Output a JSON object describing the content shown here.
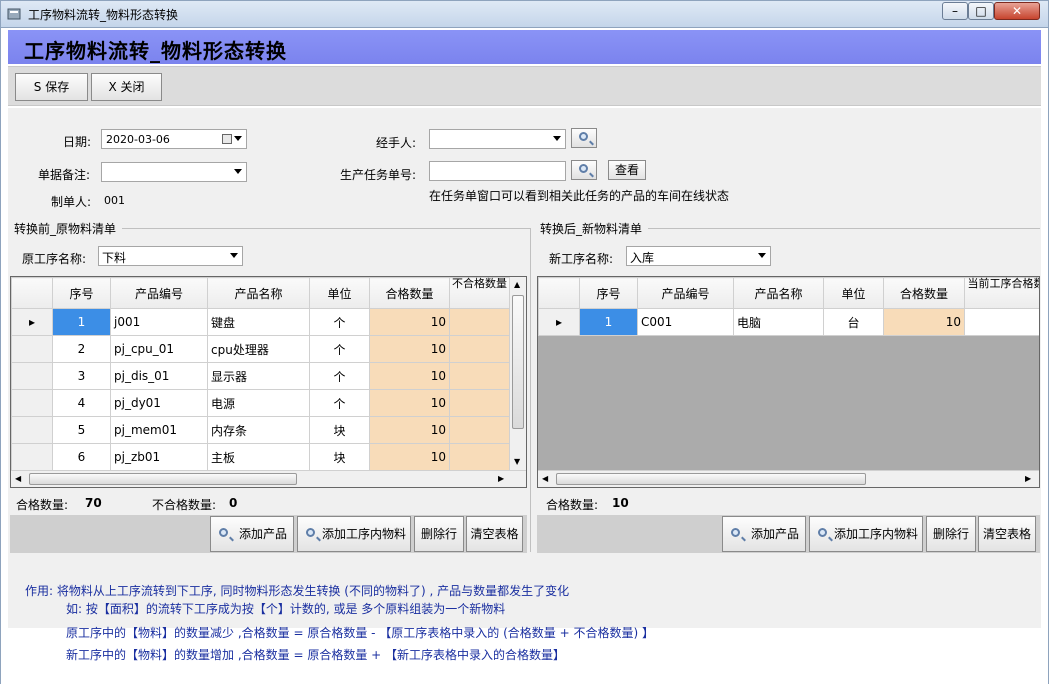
{
  "window": {
    "title": "工序物料流转_物料形态转换",
    "min": "▭",
    "max": "▢",
    "close": "✕"
  },
  "page_title": "工序物料流转_物料形态转换",
  "toolbar": {
    "save_label": "S 保存",
    "close_label": "X 关闭"
  },
  "form": {
    "date_label": "日期:",
    "date_value": "2020-03-06",
    "remark_label": "单据备注:",
    "remark_value": "",
    "maker_label": "制单人:",
    "maker_value": "001",
    "handler_label": "经手人:",
    "handler_value": "",
    "task_label": "生产任务单号:",
    "task_value": "",
    "view_label": "查看",
    "hint": "在任务单窗口可以看到相关此任务的产品的车间在线状态"
  },
  "left": {
    "section_title": "转换前_原物料清单",
    "process_label": "原工序名称:",
    "process_value": "下料",
    "columns": [
      "序号",
      "产品编号",
      "产品名称",
      "单位",
      "合格数量",
      "不合格数量"
    ],
    "rows": [
      {
        "no": "1",
        "code": "j001",
        "name": "键盘",
        "unit": "个",
        "qty": "10"
      },
      {
        "no": "2",
        "code": "pj_cpu_01",
        "name": "cpu处理器",
        "unit": "个",
        "qty": "10"
      },
      {
        "no": "3",
        "code": "pj_dis_01",
        "name": "显示器",
        "unit": "个",
        "qty": "10"
      },
      {
        "no": "4",
        "code": "pj_dy01",
        "name": "电源",
        "unit": "个",
        "qty": "10"
      },
      {
        "no": "5",
        "code": "pj_mem01",
        "name": "内存条",
        "unit": "块",
        "qty": "10"
      },
      {
        "no": "6",
        "code": "pj_zb01",
        "name": "主板",
        "unit": "块",
        "qty": "10"
      }
    ],
    "total_label": "合格数量:",
    "total_value": "70",
    "bad_label": "不合格数量:",
    "bad_value": "0",
    "buttons": {
      "add_product": "添加产品",
      "add_process": "添加工序内物料",
      "delete_row": "删除行",
      "clear": "清空表格"
    }
  },
  "right": {
    "section_title": "转换后_新物料清单",
    "process_label": "新工序名称:",
    "process_value": "入库",
    "columns": [
      "序号",
      "产品编号",
      "产品名称",
      "单位",
      "合格数量",
      "当前工序合格数量"
    ],
    "rows": [
      {
        "no": "1",
        "code": "C001",
        "name": "电脑",
        "unit": "台",
        "qty": "10"
      }
    ],
    "total_label": "合格数量:",
    "total_value": "10",
    "buttons": {
      "add_product": "添加产品",
      "add_process": "添加工序内物料",
      "delete_row": "删除行",
      "clear": "清空表格"
    }
  },
  "notes": {
    "line1": "作用: 将物料从上工序流转到下工序,  同时物料形态发生转换 (不同的物料了) , 产品与数量都发生了变化",
    "line2": "如:  按【面积】的流转下工序成为按【个】计数的,  或是 多个原料组装为一个新物料",
    "line3": "原工序中的【物料】的数量减少 ,合格数量 = 原合格数量 -  【原工序表格中录入的 (合格数量 + 不合格数量) 】",
    "line4": "新工序中的【物料】的数量增加 ,合格数量 = 原合格数量 + 【新工序表格中录入的合格数量】"
  },
  "colors": {
    "header": "#7b83ee",
    "selected": "#3c8ee6",
    "qty_cell": "#f8dcb9",
    "note_text": "#1a2fa0"
  }
}
